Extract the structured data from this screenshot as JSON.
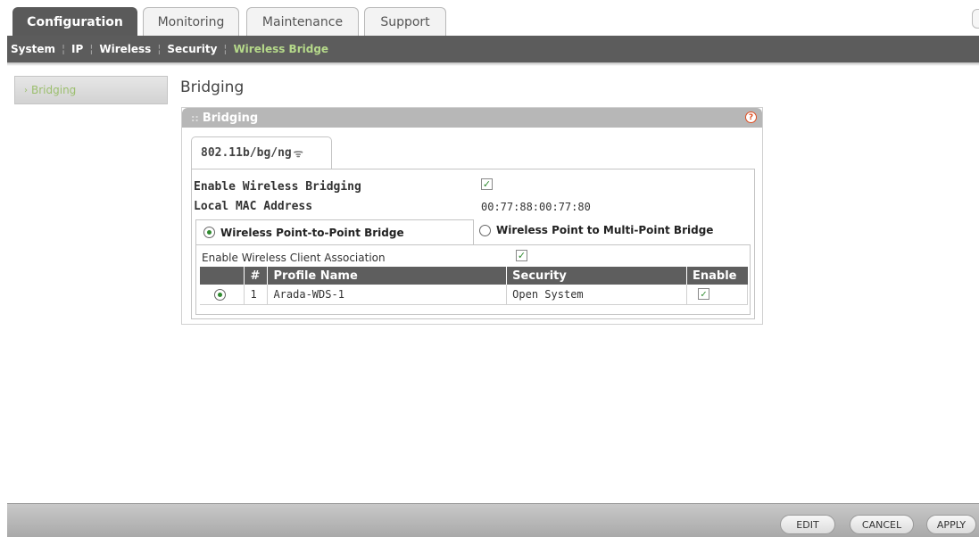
{
  "top_tabs": [
    "Configuration",
    "Monitoring",
    "Maintenance",
    "Support"
  ],
  "sub_nav": [
    "System",
    "IP",
    "Wireless",
    "Security",
    "Wireless Bridge"
  ],
  "left_nav": {
    "item": "Bridging"
  },
  "page_title": "Bridging",
  "panel": {
    "title": "Bridging",
    "help": "?",
    "radio_tab": "802.11b/bg/ng",
    "enable_bridging_label": "Enable Wireless Bridging",
    "enable_bridging_checked": true,
    "mac_label": "Local MAC Address",
    "mac_value": "00:77:88:00:77:80",
    "mode_p2p": "Wireless Point-to-Point Bridge",
    "mode_p2mp": "Wireless Point to Multi-Point Bridge",
    "client_assoc_label": "Enable Wireless Client Association",
    "table": {
      "headers": [
        "",
        "#",
        "Profile Name",
        "Security",
        "Enable"
      ],
      "rows": [
        {
          "num": "1",
          "profile": "Arada-WDS-1",
          "security": "Open System",
          "enabled": true
        }
      ]
    }
  },
  "buttons": {
    "edit": "EDIT",
    "cancel": "CANCEL",
    "apply": "APPLY"
  }
}
